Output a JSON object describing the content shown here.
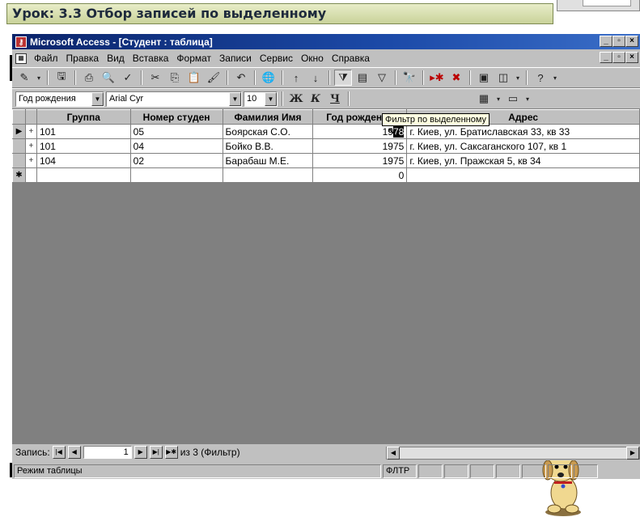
{
  "lesson": {
    "title": "Урок: 3.3 Отбор записей по выделенному"
  },
  "window": {
    "title": "Microsoft Access - [Студент : таблица]",
    "minimize": "_",
    "restore": "▫",
    "close": "×"
  },
  "menu": {
    "items": [
      "Файл",
      "Правка",
      "Вид",
      "Вставка",
      "Формат",
      "Записи",
      "Сервис",
      "Окно",
      "Справка"
    ]
  },
  "format_toolbar": {
    "field_combo": "Год рождения",
    "font_combo": "Arial Cyr",
    "size_combo": "10",
    "bold": "Ж",
    "italic": "К",
    "underline": "Ч"
  },
  "tooltip": {
    "text": "Фильтр по выделенному"
  },
  "table": {
    "columns": [
      "Группа",
      "Номер студен",
      "Фамилия Имя",
      "Год рождения",
      "Адрес"
    ],
    "rows": [
      {
        "group": "101",
        "num": "05",
        "name": "Боярская С.О.",
        "year_prefix": "19",
        "year_sel": "78",
        "address": "г. Киев, ул. Братиславская 33, кв 33",
        "current": true
      },
      {
        "group": "101",
        "num": "04",
        "name": "Бойко В.В.",
        "year": "1975",
        "address": "г. Киев, ул. Саксаганского 107, кв 1"
      },
      {
        "group": "104",
        "num": "02",
        "name": "Барабаш М.Е.",
        "year": "1975",
        "address": "г. Киев, ул. Пражская 5, кв 34"
      }
    ],
    "new_row_year": "0"
  },
  "nav": {
    "label": "Запись:",
    "current": "1",
    "of_text": "из 3 (Фильтр)"
  },
  "status": {
    "mode": "Режим таблицы",
    "filter_indicator": "ФЛТР"
  },
  "colors": {
    "title_bar": "#0a246a",
    "lesson_bg": "#c9d29a",
    "chrome": "#c0c0c0",
    "workspace": "#808080"
  }
}
